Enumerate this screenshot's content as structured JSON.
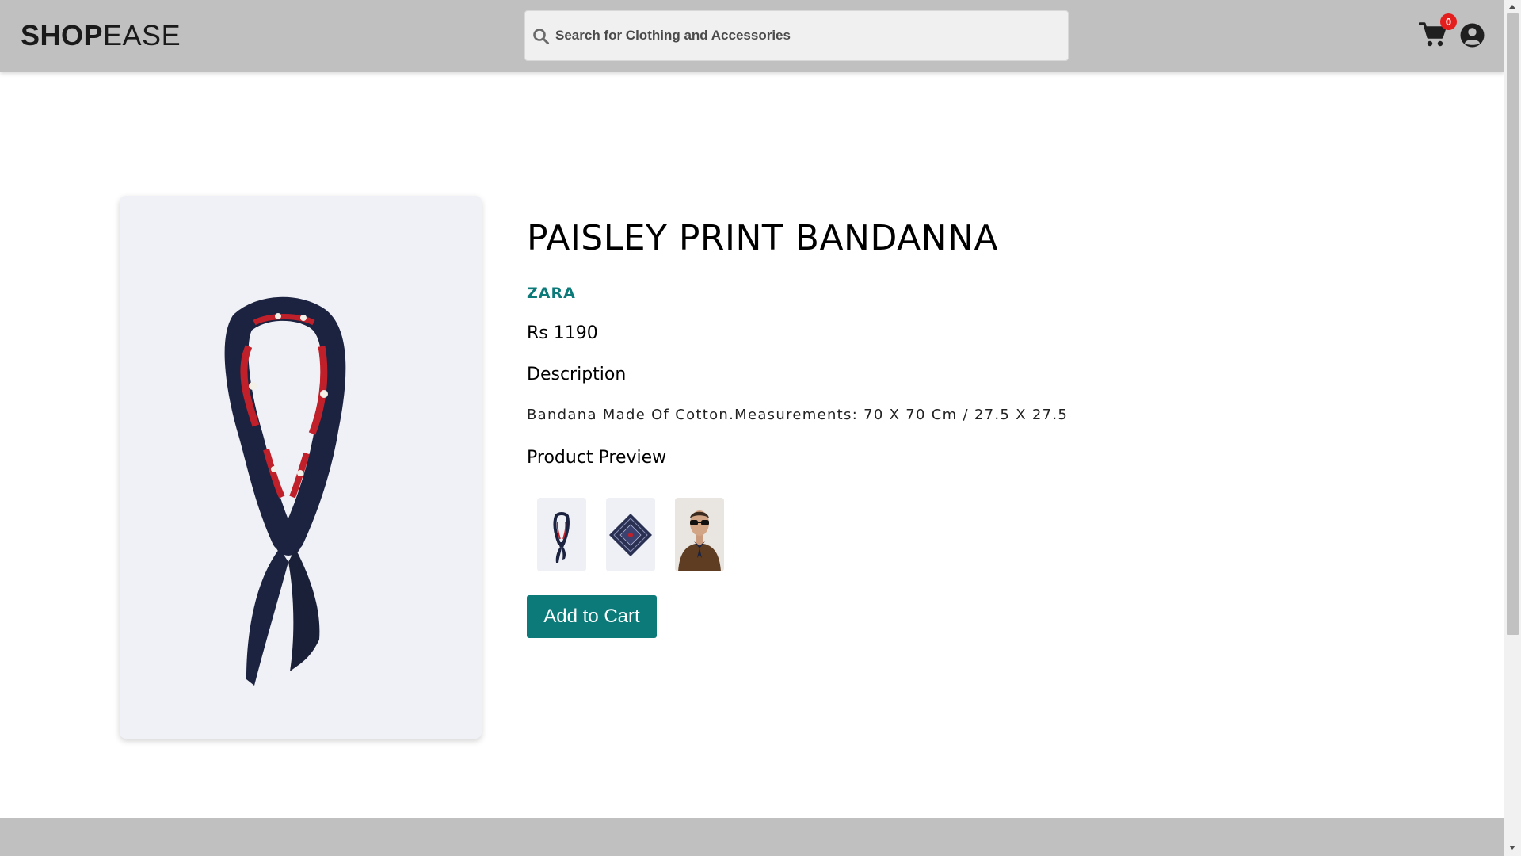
{
  "header": {
    "logo_bold": "SHOP",
    "logo_light": "EASE",
    "search_placeholder": "Search for Clothing and Accessories",
    "cart_count": "0",
    "icons": {
      "search": "search-icon",
      "cart": "cart-icon",
      "user": "user-circle-icon"
    }
  },
  "product": {
    "title": "PAISLEY PRINT BANDANNA",
    "brand": "ZARA",
    "price": "Rs 1190",
    "description_heading": "Description",
    "description": "Bandana Made Of Cotton.Measurements: 70 X 70 Cm / 27.5 X 27.5",
    "preview_heading": "Product Preview",
    "preview_images": [
      "bandanna-tied",
      "bandanna-flat",
      "bandanna-model"
    ],
    "add_to_cart_label": "Add to Cart"
  },
  "colors": {
    "accent": "#0d7a7a",
    "header_bg": "#c0c0c0",
    "badge": "#e41d1d",
    "scarf_navy": "#1c2340",
    "scarf_red": "#c0202a"
  }
}
